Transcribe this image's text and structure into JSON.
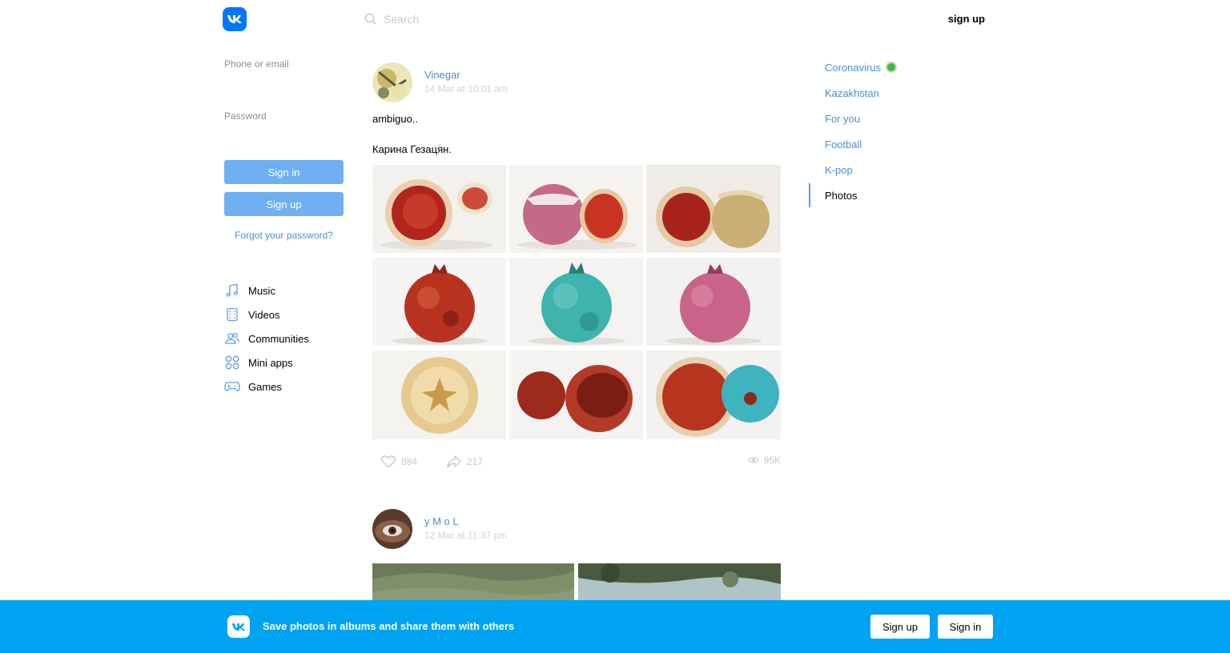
{
  "header": {
    "search_placeholder": "Search",
    "signup_link": "sign up"
  },
  "login": {
    "phone_label": "Phone or email",
    "password_label": "Password",
    "signin_button": "Sign in",
    "signup_button": "Sign up",
    "forgot_link": "Forgot your password?"
  },
  "nav": {
    "items": [
      {
        "label": "Music",
        "icon": "music-icon"
      },
      {
        "label": "Videos",
        "icon": "videos-icon"
      },
      {
        "label": "Communities",
        "icon": "communities-icon"
      },
      {
        "label": "Mini apps",
        "icon": "mini-apps-icon"
      },
      {
        "label": "Games",
        "icon": "games-icon"
      }
    ]
  },
  "posts": [
    {
      "author": "Vinegar",
      "date": "14 Mar at 10:01 am",
      "text_lines": [
        "ambiguo..",
        "Карина Гезацян."
      ],
      "likes": "884",
      "shares": "217",
      "views": "95K"
    },
    {
      "author": "y M o L",
      "date": "12 Mar at 11:37 pm"
    }
  ],
  "topics": {
    "items": [
      {
        "label": "Coronavirus"
      },
      {
        "label": "Kazakhstan"
      },
      {
        "label": "For you"
      },
      {
        "label": "Football"
      },
      {
        "label": "K-pop"
      },
      {
        "label": "Photos"
      }
    ]
  },
  "banner": {
    "text": "Save photos in albums and share them with others",
    "signup_button": "Sign up",
    "signin_button": "Sign in"
  },
  "colors": {
    "accent": "#0077ff",
    "link": "#4a8fd0",
    "button": "#6fb0f2",
    "banner": "#00a2f2",
    "online": "#4bb34b"
  }
}
